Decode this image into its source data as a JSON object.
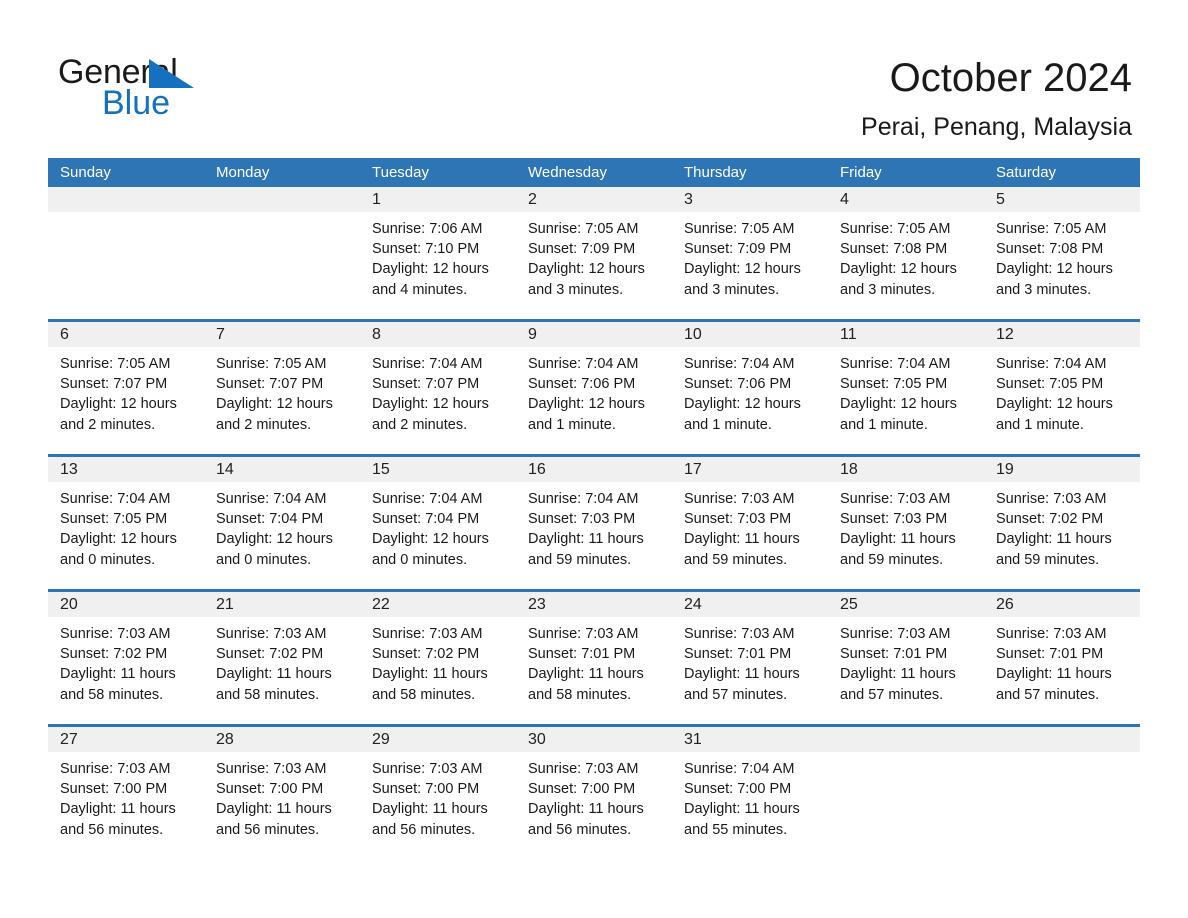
{
  "brand": {
    "name_top": "General",
    "name_bottom": "Blue",
    "accent_color": "#1570bd",
    "triangle_color": "#1570bd"
  },
  "header": {
    "month_title": "October 2024",
    "location": "Perai, Penang, Malaysia"
  },
  "theme": {
    "header_blue": "#2e75b6",
    "day_band_gray": "#f0f0f0",
    "text_color": "#1a1a1a",
    "header_text_color": "#ffffff"
  },
  "weekdays": [
    "Sunday",
    "Monday",
    "Tuesday",
    "Wednesday",
    "Thursday",
    "Friday",
    "Saturday"
  ],
  "weeks": [
    [
      {
        "day": "",
        "empty": true,
        "lines": []
      },
      {
        "day": "",
        "empty": true,
        "lines": []
      },
      {
        "day": "1",
        "lines": [
          "Sunrise: 7:06 AM",
          "Sunset: 7:10 PM",
          "Daylight: 12 hours",
          "and 4 minutes."
        ]
      },
      {
        "day": "2",
        "lines": [
          "Sunrise: 7:05 AM",
          "Sunset: 7:09 PM",
          "Daylight: 12 hours",
          "and 3 minutes."
        ]
      },
      {
        "day": "3",
        "lines": [
          "Sunrise: 7:05 AM",
          "Sunset: 7:09 PM",
          "Daylight: 12 hours",
          "and 3 minutes."
        ]
      },
      {
        "day": "4",
        "lines": [
          "Sunrise: 7:05 AM",
          "Sunset: 7:08 PM",
          "Daylight: 12 hours",
          "and 3 minutes."
        ]
      },
      {
        "day": "5",
        "lines": [
          "Sunrise: 7:05 AM",
          "Sunset: 7:08 PM",
          "Daylight: 12 hours",
          "and 3 minutes."
        ]
      }
    ],
    [
      {
        "day": "6",
        "lines": [
          "Sunrise: 7:05 AM",
          "Sunset: 7:07 PM",
          "Daylight: 12 hours",
          "and 2 minutes."
        ]
      },
      {
        "day": "7",
        "lines": [
          "Sunrise: 7:05 AM",
          "Sunset: 7:07 PM",
          "Daylight: 12 hours",
          "and 2 minutes."
        ]
      },
      {
        "day": "8",
        "lines": [
          "Sunrise: 7:04 AM",
          "Sunset: 7:07 PM",
          "Daylight: 12 hours",
          "and 2 minutes."
        ]
      },
      {
        "day": "9",
        "lines": [
          "Sunrise: 7:04 AM",
          "Sunset: 7:06 PM",
          "Daylight: 12 hours",
          "and 1 minute."
        ]
      },
      {
        "day": "10",
        "lines": [
          "Sunrise: 7:04 AM",
          "Sunset: 7:06 PM",
          "Daylight: 12 hours",
          "and 1 minute."
        ]
      },
      {
        "day": "11",
        "lines": [
          "Sunrise: 7:04 AM",
          "Sunset: 7:05 PM",
          "Daylight: 12 hours",
          "and 1 minute."
        ]
      },
      {
        "day": "12",
        "lines": [
          "Sunrise: 7:04 AM",
          "Sunset: 7:05 PM",
          "Daylight: 12 hours",
          "and 1 minute."
        ]
      }
    ],
    [
      {
        "day": "13",
        "lines": [
          "Sunrise: 7:04 AM",
          "Sunset: 7:05 PM",
          "Daylight: 12 hours",
          "and 0 minutes."
        ]
      },
      {
        "day": "14",
        "lines": [
          "Sunrise: 7:04 AM",
          "Sunset: 7:04 PM",
          "Daylight: 12 hours",
          "and 0 minutes."
        ]
      },
      {
        "day": "15",
        "lines": [
          "Sunrise: 7:04 AM",
          "Sunset: 7:04 PM",
          "Daylight: 12 hours",
          "and 0 minutes."
        ]
      },
      {
        "day": "16",
        "lines": [
          "Sunrise: 7:04 AM",
          "Sunset: 7:03 PM",
          "Daylight: 11 hours",
          "and 59 minutes."
        ]
      },
      {
        "day": "17",
        "lines": [
          "Sunrise: 7:03 AM",
          "Sunset: 7:03 PM",
          "Daylight: 11 hours",
          "and 59 minutes."
        ]
      },
      {
        "day": "18",
        "lines": [
          "Sunrise: 7:03 AM",
          "Sunset: 7:03 PM",
          "Daylight: 11 hours",
          "and 59 minutes."
        ]
      },
      {
        "day": "19",
        "lines": [
          "Sunrise: 7:03 AM",
          "Sunset: 7:02 PM",
          "Daylight: 11 hours",
          "and 59 minutes."
        ]
      }
    ],
    [
      {
        "day": "20",
        "lines": [
          "Sunrise: 7:03 AM",
          "Sunset: 7:02 PM",
          "Daylight: 11 hours",
          "and 58 minutes."
        ]
      },
      {
        "day": "21",
        "lines": [
          "Sunrise: 7:03 AM",
          "Sunset: 7:02 PM",
          "Daylight: 11 hours",
          "and 58 minutes."
        ]
      },
      {
        "day": "22",
        "lines": [
          "Sunrise: 7:03 AM",
          "Sunset: 7:02 PM",
          "Daylight: 11 hours",
          "and 58 minutes."
        ]
      },
      {
        "day": "23",
        "lines": [
          "Sunrise: 7:03 AM",
          "Sunset: 7:01 PM",
          "Daylight: 11 hours",
          "and 58 minutes."
        ]
      },
      {
        "day": "24",
        "lines": [
          "Sunrise: 7:03 AM",
          "Sunset: 7:01 PM",
          "Daylight: 11 hours",
          "and 57 minutes."
        ]
      },
      {
        "day": "25",
        "lines": [
          "Sunrise: 7:03 AM",
          "Sunset: 7:01 PM",
          "Daylight: 11 hours",
          "and 57 minutes."
        ]
      },
      {
        "day": "26",
        "lines": [
          "Sunrise: 7:03 AM",
          "Sunset: 7:01 PM",
          "Daylight: 11 hours",
          "and 57 minutes."
        ]
      }
    ],
    [
      {
        "day": "27",
        "lines": [
          "Sunrise: 7:03 AM",
          "Sunset: 7:00 PM",
          "Daylight: 11 hours",
          "and 56 minutes."
        ]
      },
      {
        "day": "28",
        "lines": [
          "Sunrise: 7:03 AM",
          "Sunset: 7:00 PM",
          "Daylight: 11 hours",
          "and 56 minutes."
        ]
      },
      {
        "day": "29",
        "lines": [
          "Sunrise: 7:03 AM",
          "Sunset: 7:00 PM",
          "Daylight: 11 hours",
          "and 56 minutes."
        ]
      },
      {
        "day": "30",
        "lines": [
          "Sunrise: 7:03 AM",
          "Sunset: 7:00 PM",
          "Daylight: 11 hours",
          "and 56 minutes."
        ]
      },
      {
        "day": "31",
        "lines": [
          "Sunrise: 7:04 AM",
          "Sunset: 7:00 PM",
          "Daylight: 11 hours",
          "and 55 minutes."
        ]
      },
      {
        "day": "",
        "empty": true,
        "lines": []
      },
      {
        "day": "",
        "empty": true,
        "lines": []
      }
    ]
  ]
}
